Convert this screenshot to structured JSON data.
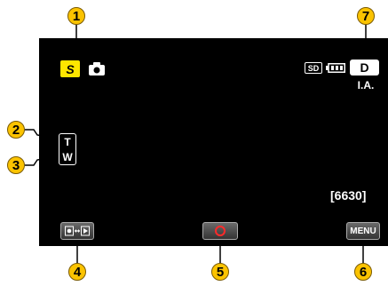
{
  "callouts": [
    "1",
    "2",
    "3",
    "4",
    "5",
    "6",
    "7"
  ],
  "status_bar": {
    "silent_mode_icon": "S",
    "camera_icon": "still-camera-icon",
    "sd_label": "SD",
    "battery_icon": "battery-icon",
    "mode_button": "D",
    "mode_label": "I.A."
  },
  "zoom": {
    "tele": "T",
    "wide": "W"
  },
  "remaining_shots": "[6630]",
  "buttons": {
    "playback_icon": "playback-switch-icon",
    "record_icon": "record-icon",
    "menu": "MENU"
  },
  "colors": {
    "callout": "#fbc300",
    "silent_icon": "#ffe600",
    "screen": "#000000"
  }
}
